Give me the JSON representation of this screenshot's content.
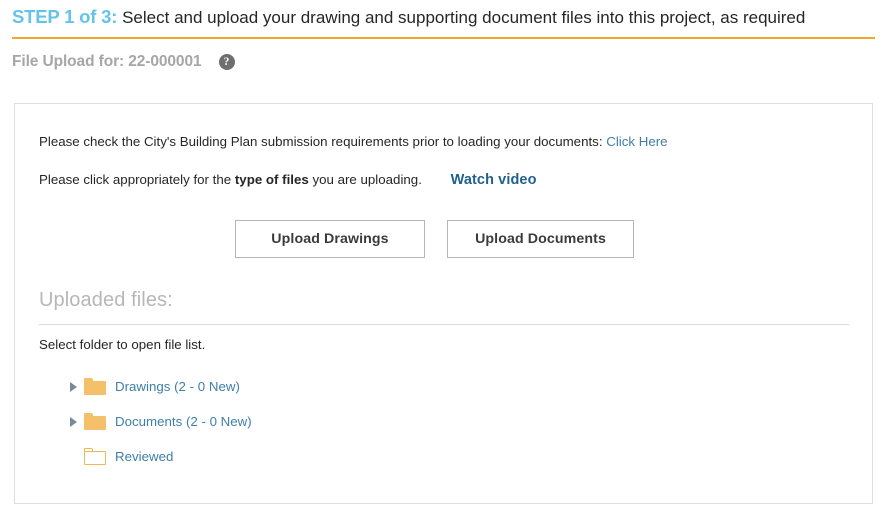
{
  "header": {
    "step_label": "STEP 1 of 3:",
    "step_description": "Select and upload your drawing and supporting document files into this project, as required",
    "subtitle": "File Upload for: 22-000001",
    "help_icon": "help-question-icon",
    "help_glyph": "?",
    "accent_rule_color": "#f0a829",
    "step_label_color": "#63c3e8"
  },
  "card": {
    "instruction_1_prefix": "Please check the City's Building Plan submission requirements prior to loading your documents:",
    "instruction_1_link": "Click Here",
    "instruction_2_prefix": "Please click appropriately for the",
    "instruction_2_bold": "type of files",
    "instruction_2_suffix": "you are uploading.",
    "watch_video_link": "Watch video",
    "buttons": {
      "upload_drawings": "Upload Drawings",
      "upload_documents": "Upload Documents"
    },
    "uploaded_files_title": "Uploaded files:",
    "select_folder_note": "Select folder to open file list.",
    "folders": [
      {
        "label": "Drawings (2 - 0 New)",
        "icon": "folder-filled-icon",
        "has_disclosure": true,
        "expanded": false
      },
      {
        "label": "Documents (2 - 0 New)",
        "icon": "folder-filled-icon",
        "has_disclosure": true,
        "expanded": false
      },
      {
        "label": "Reviewed",
        "icon": "folder-outline-icon",
        "has_disclosure": false,
        "expanded": false
      }
    ],
    "link_color": "#3f7fa8",
    "folder_color": "#f5c06a"
  }
}
